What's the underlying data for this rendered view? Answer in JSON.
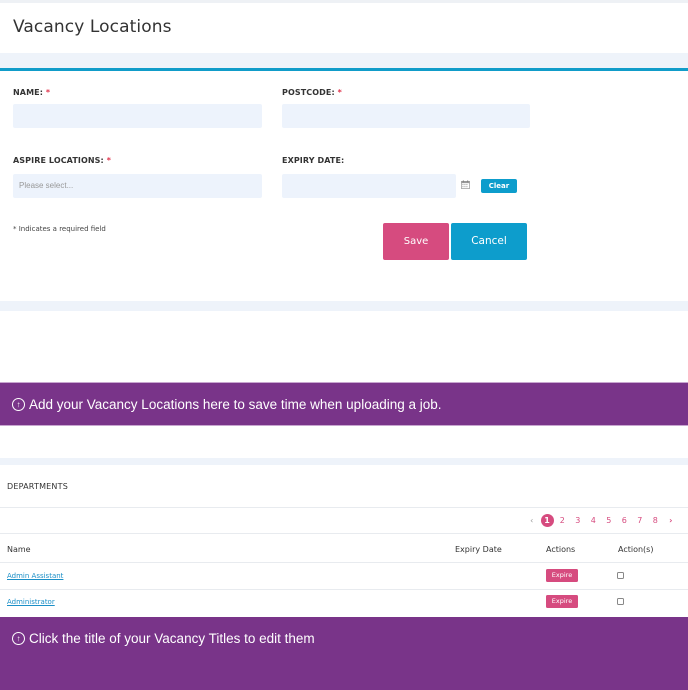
{
  "page": {
    "title": "Vacancy Locations"
  },
  "form": {
    "name_label": "NAME:",
    "name_value": "",
    "postcode_label": "POSTCODE:",
    "postcode_value": "",
    "aspire_label": "ASPIRE LOCATIONS:",
    "aspire_placeholder": "Please select...",
    "expiry_label": "EXPIRY DATE:",
    "expiry_value": "",
    "required_marker": "*",
    "clear_label": "Clear",
    "required_note": "* Indicates a required field",
    "save_label": "Save",
    "cancel_label": "Cancel",
    "icons": {
      "calendar": "calendar-icon"
    }
  },
  "banners": {
    "top": {
      "icon": "arrow-up-circle-icon",
      "glyph": "↑",
      "text": "Add your Vacancy Locations here to save time when uploading a job."
    },
    "bottom": {
      "icon": "arrow-up-circle-icon",
      "glyph": "↑",
      "text": "Click the title of your Vacancy Titles to edit them"
    }
  },
  "departments": {
    "title": "DEPARTMENTS",
    "pagination": {
      "prev": "‹",
      "pages": [
        "1",
        "2",
        "3",
        "4",
        "5",
        "6",
        "7",
        "8"
      ],
      "current": "1",
      "next": "›"
    },
    "columns": [
      "Name",
      "Expiry Date",
      "Actions",
      "Action(s)"
    ],
    "rows": [
      {
        "name": "Admin Assistant",
        "expiry_date": "",
        "action": "Expire",
        "checked": false
      },
      {
        "name": "Administrator",
        "expiry_date": "",
        "action": "Expire",
        "checked": false
      }
    ]
  },
  "colors": {
    "accent_blue": "#0d9dcc",
    "accent_pink": "#d64b7f",
    "banner_purple": "#793489",
    "required_red": "#e0344c",
    "link_blue": "#1b8fc7"
  }
}
